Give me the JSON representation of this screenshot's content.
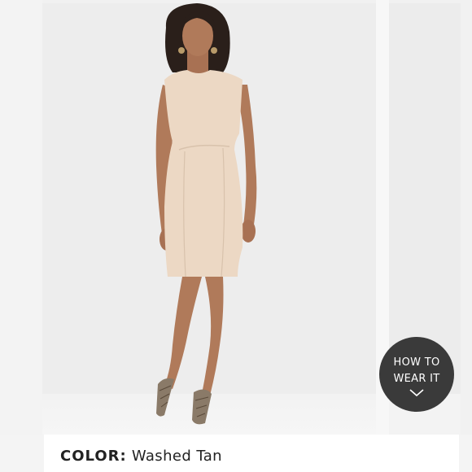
{
  "color": {
    "label": "COLOR:",
    "value": "Washed Tan"
  },
  "how_to_wear": {
    "line1": "HOW TO",
    "line2": "WEAR IT",
    "icon": "chevron-down-icon"
  },
  "product_image": {
    "description_colors": {
      "dress": "#ecd8c4",
      "skin": "#b07a5a",
      "hair": "#2a1f1a"
    }
  }
}
